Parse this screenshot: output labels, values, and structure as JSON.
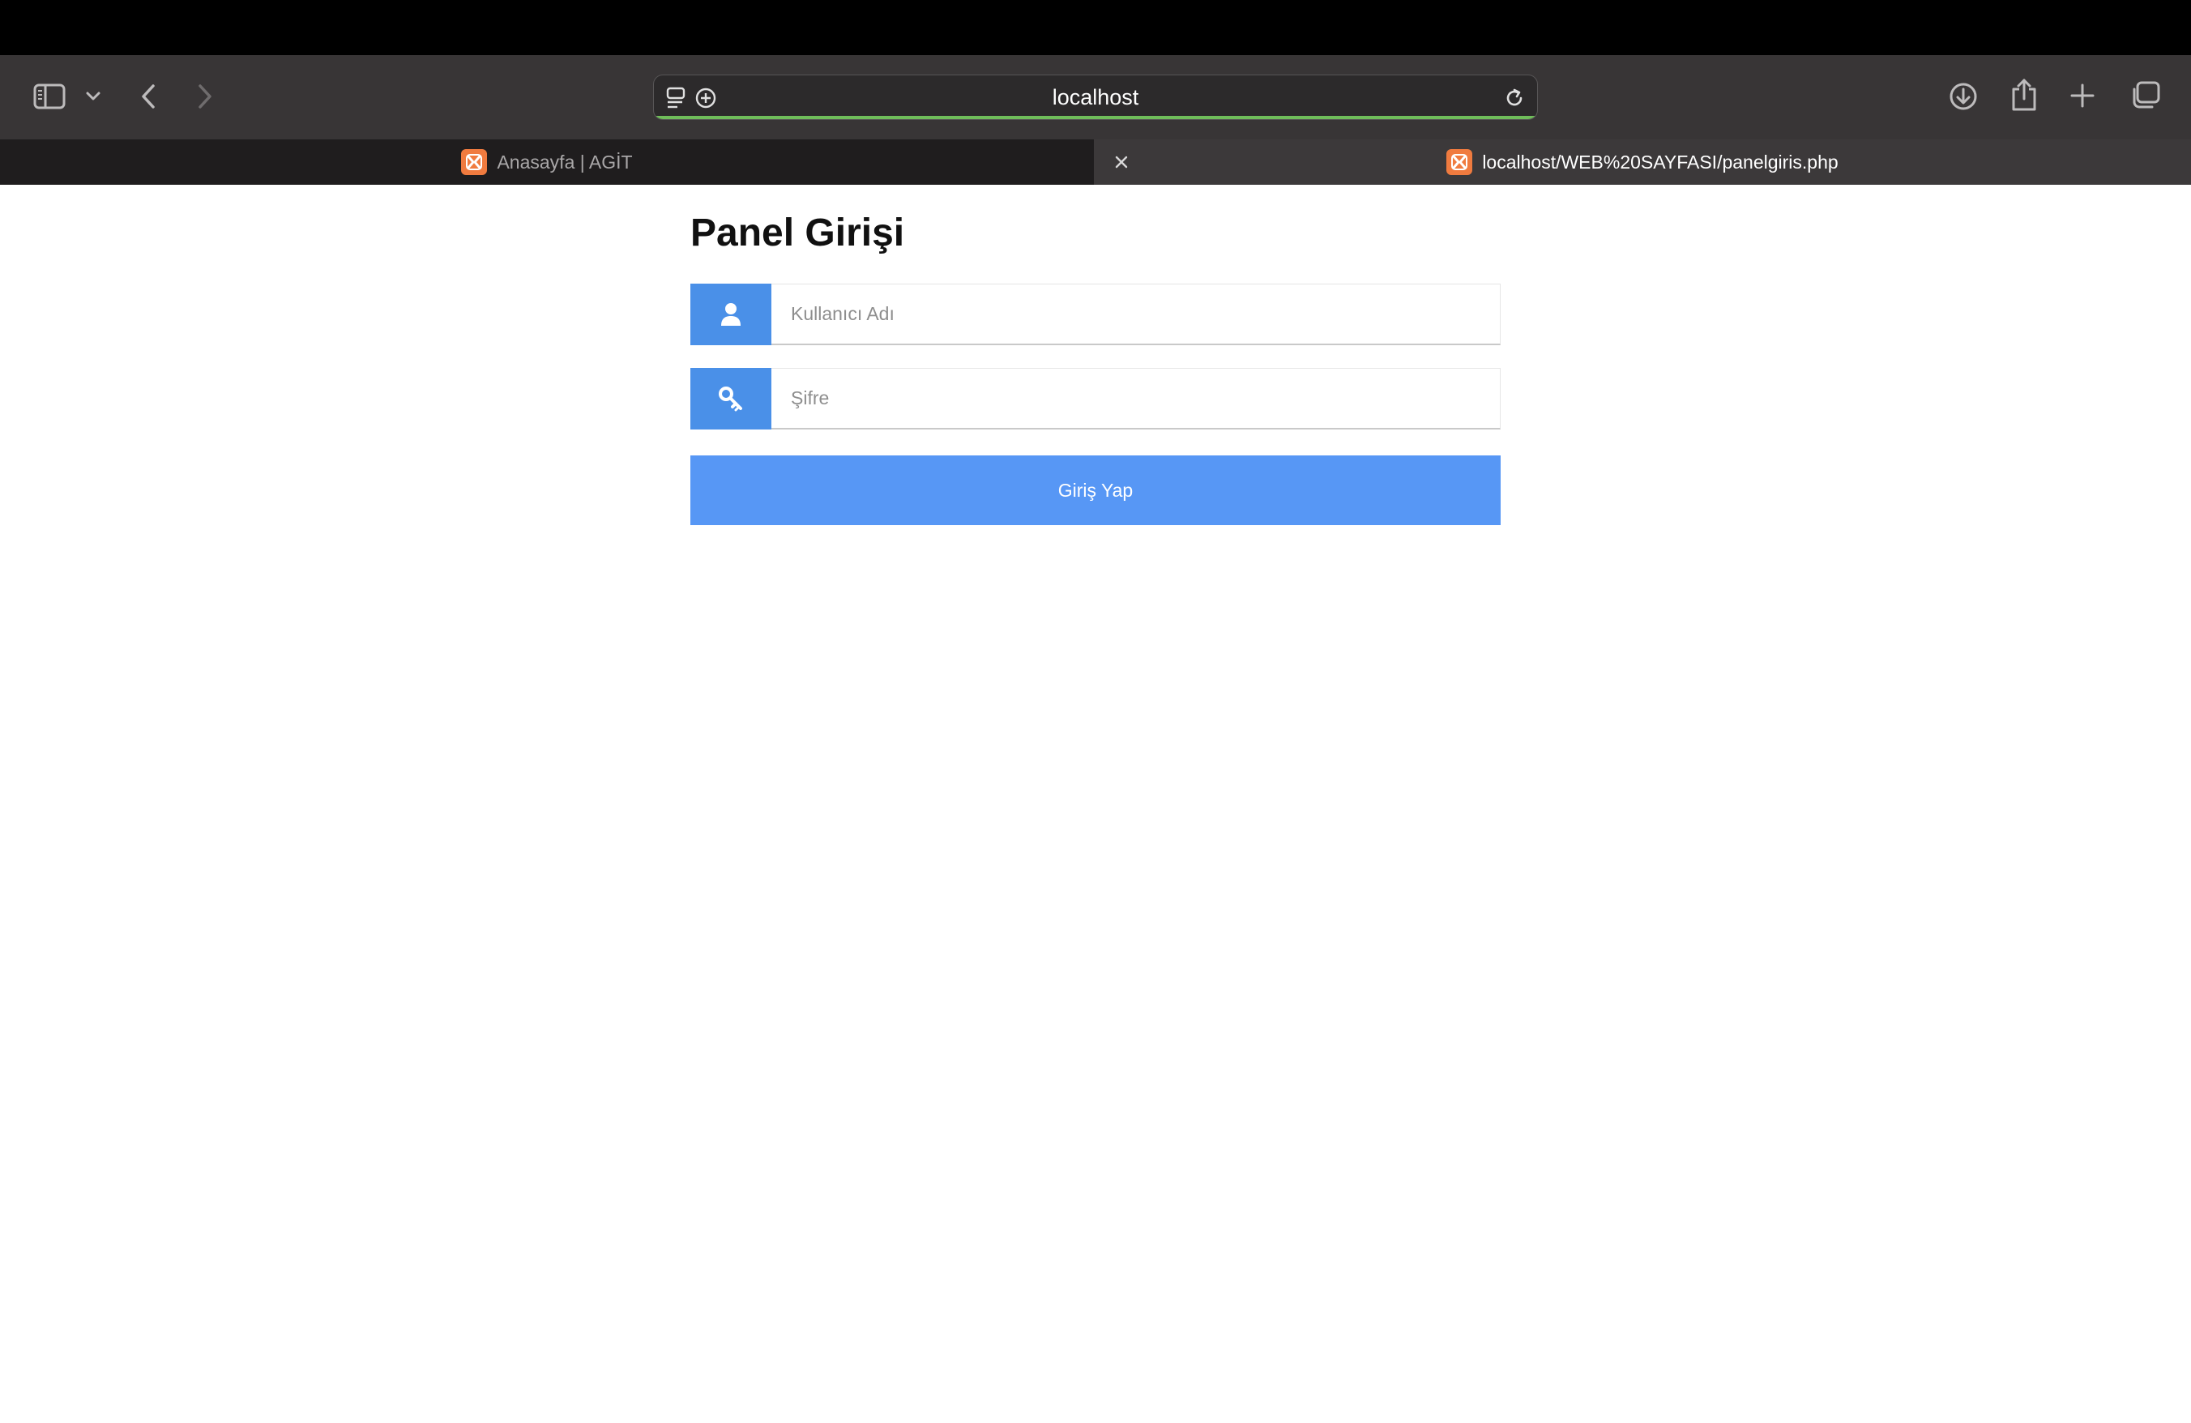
{
  "browser": {
    "address_bar": {
      "url_text": "localhost",
      "load_progress": 1.0
    },
    "tabs": [
      {
        "title": "Anasayfa | AGİT",
        "active": false,
        "favicon": "xampp-icon"
      },
      {
        "title": "localhost/WEB%20SAYFASI/panelgiris.php",
        "active": true,
        "favicon": "xampp-icon"
      }
    ],
    "toolbar_icons": [
      "sidebar-icon",
      "chevron-down-icon",
      "back-icon",
      "forward-icon",
      "reader-icon",
      "add-icon",
      "reload-icon",
      "download-icon",
      "share-icon",
      "new-tab-icon",
      "tab-overview-icon"
    ]
  },
  "page": {
    "title": "Panel Girişi",
    "username": {
      "placeholder": "Kullanıcı Adı",
      "icon": "user-icon",
      "value": ""
    },
    "password": {
      "placeholder": "Şifre",
      "icon": "key-icon",
      "value": ""
    },
    "submit_label": "Giriş Yap"
  },
  "colors": {
    "accent": "#4a90e8",
    "button": "#5797f5",
    "toolbar_bg": "#383536",
    "tab_favicon": "#f07b3f"
  }
}
